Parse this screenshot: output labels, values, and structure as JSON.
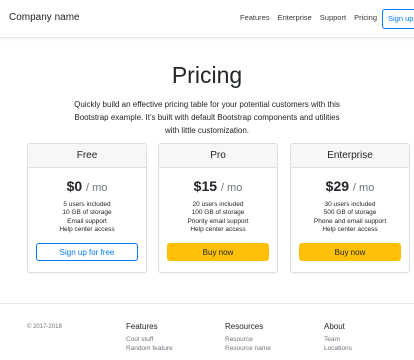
{
  "navbar": {
    "brand": "Company name",
    "links": [
      "Features",
      "Enterprise",
      "Support",
      "Pricing"
    ],
    "signup_label": "Sign up"
  },
  "hero": {
    "title": "Pricing",
    "lead": "Quickly build an effective pricing table for your potential customers with this Bootstrap example. It's built with default Bootstrap components and utilities with little customization."
  },
  "plans": [
    {
      "name": "Free",
      "price": "$0",
      "period": "/ mo",
      "features": [
        "5 users included",
        "10 GB of storage",
        "Email support",
        "Help center access"
      ],
      "button": "Sign up for free",
      "button_style": "outline"
    },
    {
      "name": "Pro",
      "price": "$15",
      "period": "/ mo",
      "features": [
        "20 users included",
        "100 GB of storage",
        "Priority email support",
        "Help center access"
      ],
      "button": "Buy now",
      "button_style": "warning"
    },
    {
      "name": "Enterprise",
      "price": "$29",
      "period": "/ mo",
      "features": [
        "30 users included",
        "500 GB of storage",
        "Phone and email support",
        "Help center access"
      ],
      "button": "Buy now",
      "button_style": "warning"
    }
  ],
  "footer": {
    "copyright": "© 2017-2018",
    "columns": [
      {
        "title": "Features",
        "links": [
          "Cool stuff",
          "Random feature"
        ]
      },
      {
        "title": "Resources",
        "links": [
          "Resource",
          "Resource name"
        ]
      },
      {
        "title": "About",
        "links": [
          "Team",
          "Locations"
        ]
      }
    ]
  },
  "colors": {
    "primary": "#007bff",
    "warning": "#ffc107"
  }
}
